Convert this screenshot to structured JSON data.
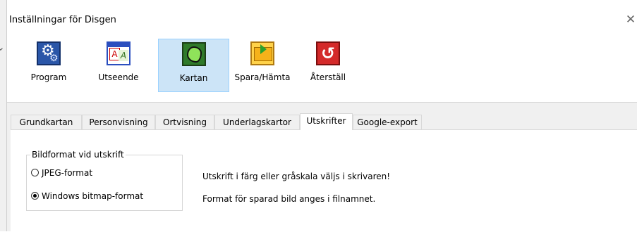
{
  "window": {
    "title": "Inställningar för Disgen"
  },
  "toolbar": {
    "items": [
      {
        "label": "Program",
        "selected": false
      },
      {
        "label": "Utseende",
        "selected": false
      },
      {
        "label": "Kartan",
        "selected": true
      },
      {
        "label": "Spara/Hämta",
        "selected": false
      },
      {
        "label": "Återställ",
        "selected": false
      }
    ]
  },
  "tabs": [
    {
      "label": "Grundkartan",
      "active": false
    },
    {
      "label": "Personvisning",
      "active": false
    },
    {
      "label": "Ortvisning",
      "active": false
    },
    {
      "label": "Underlagskartor",
      "active": false
    },
    {
      "label": "Utskrifter",
      "active": true
    },
    {
      "label": "Google-export",
      "active": false
    }
  ],
  "print": {
    "group_title": "Bildformat vid utskrift",
    "options": [
      {
        "label": "JPEG-format",
        "selected": false
      },
      {
        "label": "Windows bitmap-format",
        "selected": true
      }
    ],
    "info_lines": [
      "Utskrift i färg eller gråskala väljs i skrivaren!",
      "Format för sparad bild anges i filnamnet."
    ]
  },
  "colors": {
    "selected_bg": "#cce4f7",
    "selected_border": "#99d1ff",
    "dialog_bg": "#f0f0f0"
  }
}
